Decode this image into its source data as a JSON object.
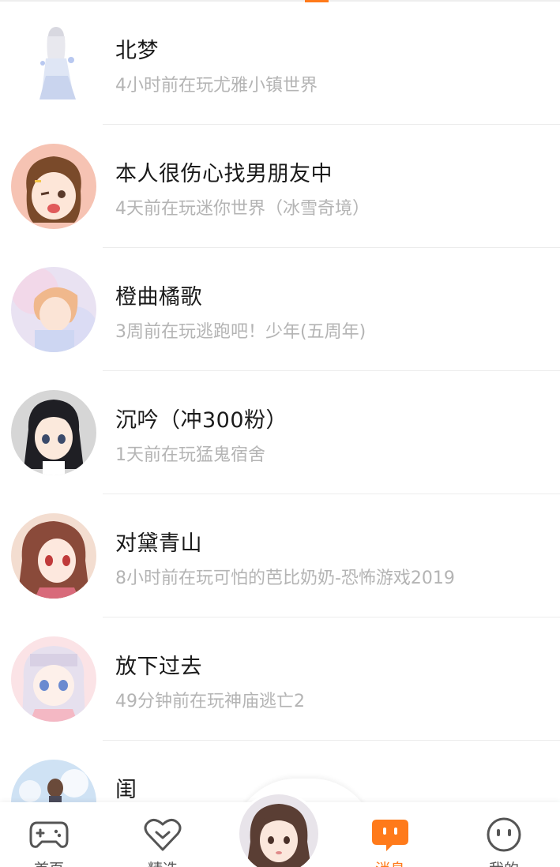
{
  "friends": [
    {
      "name": "北梦",
      "status": "4小时前在玩尤雅小镇世界"
    },
    {
      "name": "本人很伤心找男朋友中",
      "status": "4天前在玩迷你世界（冰雪奇境）"
    },
    {
      "name": "橙曲橘歌",
      "status": "3周前在玩逃跑吧！少年(五周年)"
    },
    {
      "name": "沉吟（冲300粉）",
      "status": "1天前在玩猛鬼宿舍"
    },
    {
      "name": "对黛青山",
      "status": "8小时前在玩可怕的芭比奶奶-恐怖游戏2019"
    },
    {
      "name": "放下过去",
      "status": "49分钟前在玩神庙逃亡2"
    },
    {
      "name": "闺",
      "status": ""
    }
  ],
  "nav": {
    "home": "首页",
    "featured": "精选",
    "messages": "消息",
    "me": "我的"
  },
  "colors": {
    "accent": "#ff7a1a",
    "name_text": "#1a1a1a",
    "status_text": "#b4b4b4"
  },
  "icons": {
    "home": "gamepad-icon",
    "featured": "heart-icon",
    "messages": "chat-bubble-icon",
    "me": "face-icon"
  }
}
